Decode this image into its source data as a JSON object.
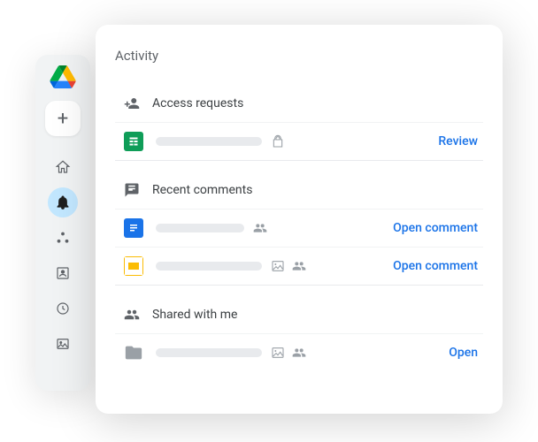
{
  "panel": {
    "title": "Activity"
  },
  "sections": {
    "access": {
      "label": "Access requests"
    },
    "comments": {
      "label": "Recent comments"
    },
    "shared": {
      "label": "Shared with me"
    }
  },
  "rows": {
    "access0": {
      "action": "Review"
    },
    "comments0": {
      "action": "Open comment"
    },
    "comments1": {
      "action": "Open comment"
    },
    "shared0": {
      "action": "Open"
    }
  }
}
